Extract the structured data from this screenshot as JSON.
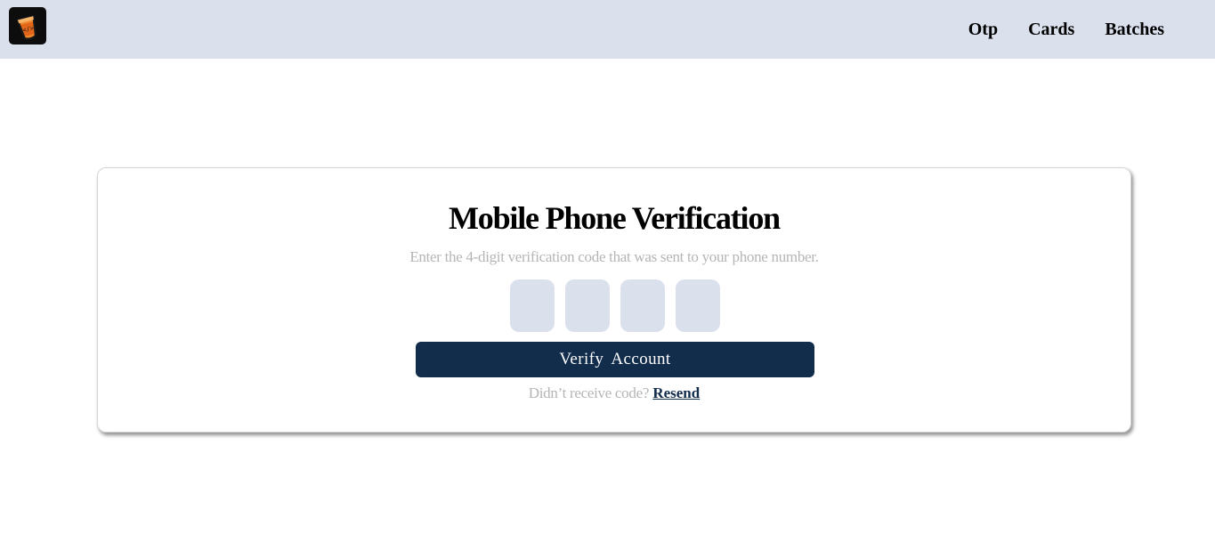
{
  "header": {
    "logo_icon": "drink-cup-code-logo-icon",
    "nav": [
      {
        "label": "Otp"
      },
      {
        "label": "Cards"
      },
      {
        "label": "Batches"
      }
    ]
  },
  "verification": {
    "title": "Mobile Phone Verification",
    "subtitle": "Enter the 4-digit verification code that was sent to your phone number.",
    "otp_values": [
      "",
      "",
      "",
      ""
    ],
    "verify_label": "Verify  Account",
    "resend_prompt": "Didn’t receive code?",
    "resend_label": "Resend"
  },
  "colors": {
    "navbar_bg": "#dae0ec",
    "button_bg": "#122c4c",
    "otp_box_bg": "#dae0ec",
    "muted_text": "#b5b5b5"
  }
}
